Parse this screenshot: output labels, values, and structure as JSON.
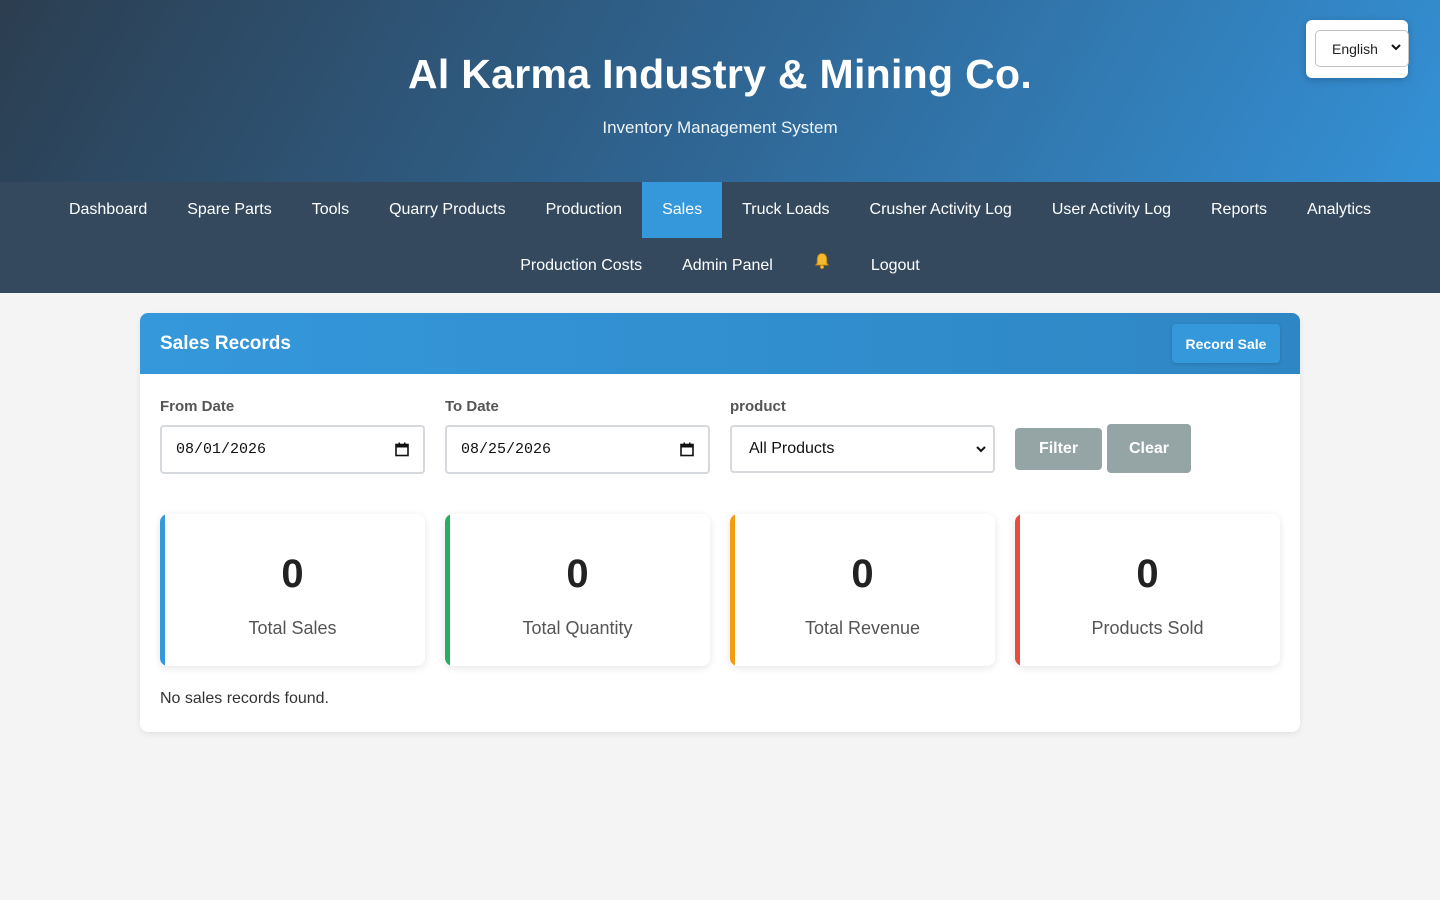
{
  "header": {
    "title": "Al Karma Industry & Mining Co.",
    "subtitle": "Inventory Management System",
    "language": {
      "selected": "English"
    }
  },
  "nav": {
    "row1": [
      "Dashboard",
      "Spare Parts",
      "Tools",
      "Quarry Products",
      "Production",
      "Sales",
      "Truck Loads",
      "Crusher Activity Log",
      "User Activity Log",
      "Reports",
      "Analytics"
    ],
    "row2": {
      "production_costs": "Production Costs",
      "admin_panel": "Admin Panel",
      "logout": "Logout"
    },
    "active": "Sales",
    "bell_icon": "bell-icon"
  },
  "card": {
    "title": "Sales Records",
    "record_button": "Record Sale"
  },
  "filters": {
    "from_label": "From Date",
    "from_value": "08/01/2026",
    "to_label": "To Date",
    "to_value": "08/25/2026",
    "product_label": "product",
    "product_selected": "All Products",
    "filter_button": "Filter",
    "clear_button": "Clear"
  },
  "stats": [
    {
      "value": "0",
      "label": "Total Sales",
      "color": "#3498db"
    },
    {
      "value": "0",
      "label": "Total Quantity",
      "color": "#27ae60"
    },
    {
      "value": "0",
      "label": "Total Revenue",
      "color": "#f39c12"
    },
    {
      "value": "0",
      "label": "Products Sold",
      "color": "#e74c3c"
    }
  ],
  "empty_message": "No sales records found.",
  "colors": {
    "accent": "#3498db",
    "nav_bg": "#34495e",
    "button_gray": "#95a5a6"
  }
}
